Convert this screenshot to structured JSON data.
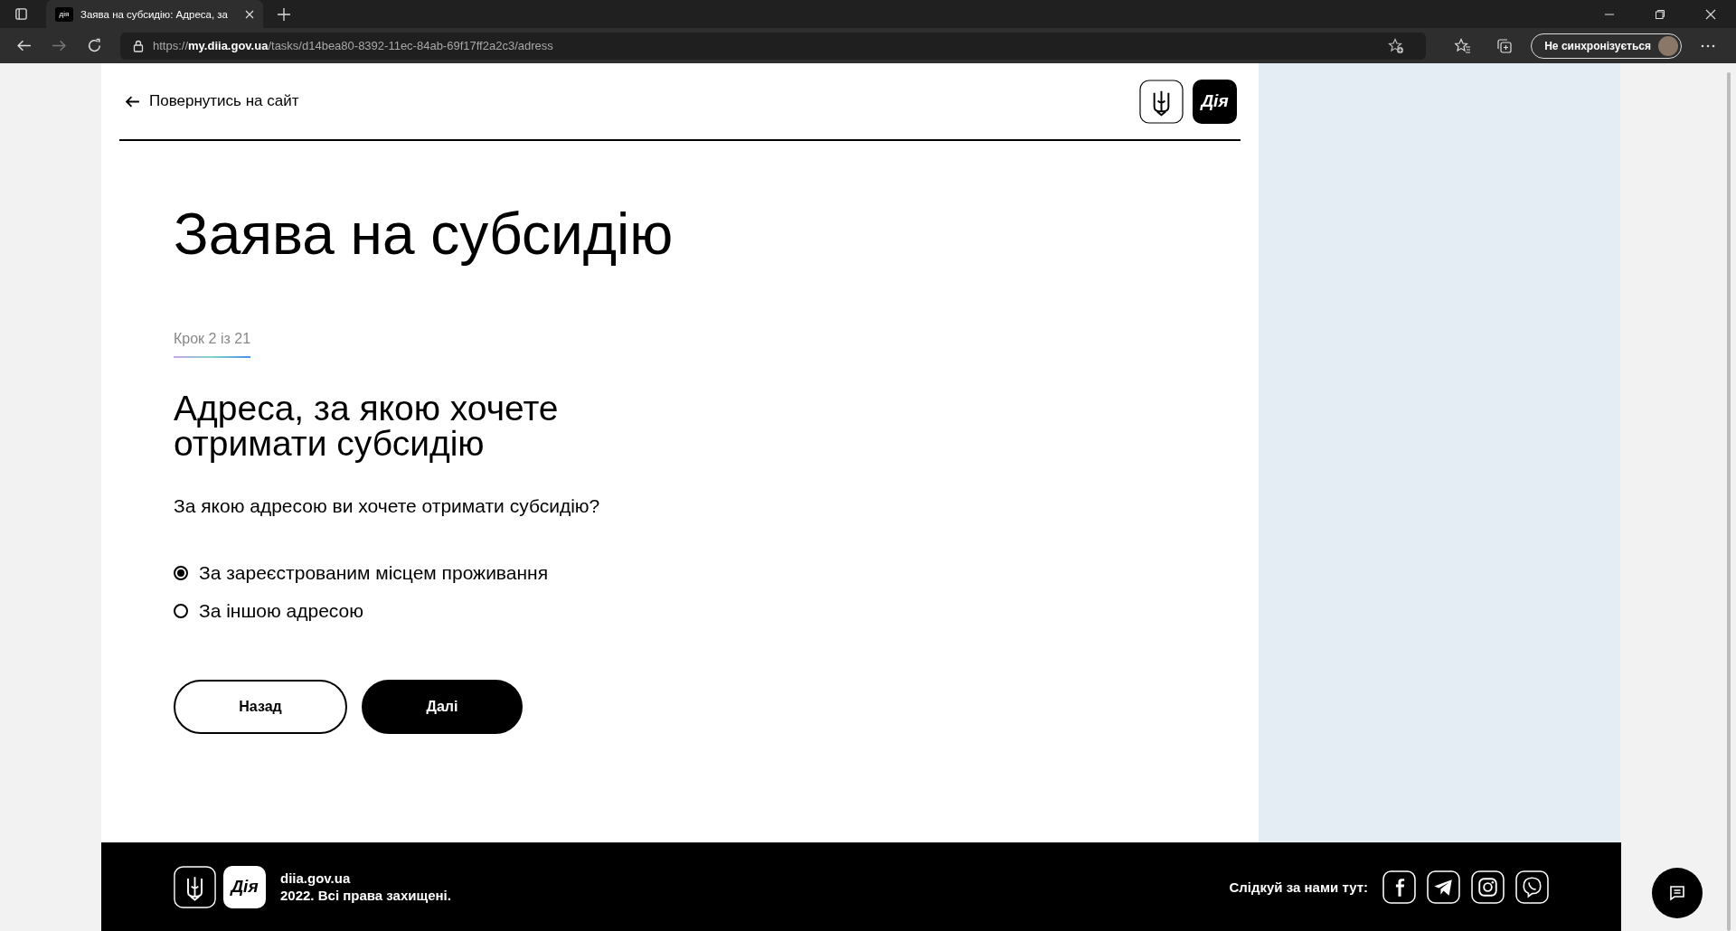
{
  "browser": {
    "tab_title": "Заява на субсидію: Адреса, за",
    "url": "https://**my.diia.gov.ua**/tasks/d14bea80-8392-11ec-84ab-69f17ff2a2c3/adress",
    "sync_label": "Не синхронізується",
    "tab_logo": "дія"
  },
  "header": {
    "back_link": "Повернутись на сайт",
    "logo_text": "Дія"
  },
  "title": "Заява на субсидію",
  "step": {
    "label": "Крок 2 із 21",
    "level": 0.095
  },
  "heading": "Адреса, за якою хочете отримати субсидію",
  "question": "За якою адресою ви хочете отримати субсидію?",
  "options": [
    {
      "label": "За зареєстрованим місцем проживання",
      "selected": true
    },
    {
      "label": "За іншою адресою",
      "selected": false
    }
  ],
  "buttons": [
    {
      "label": "Назад",
      "kind": "secondary"
    },
    {
      "label": "Далі",
      "kind": "primary"
    }
  ],
  "footer": {
    "logo_text": "Дія",
    "site": "diia.gov.ua",
    "copyright": "2022. Всі права захищені.",
    "follow_label": "Слідкуй за нами тут:"
  }
}
